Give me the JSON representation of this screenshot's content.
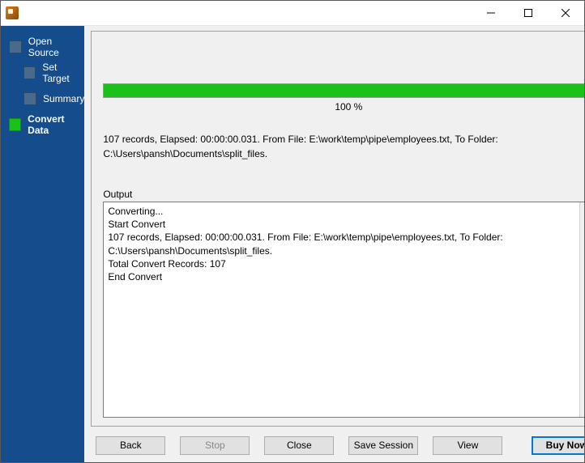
{
  "sidebar": {
    "items": [
      {
        "label": "Open Source"
      },
      {
        "label": "Set Target"
      },
      {
        "label": "Summary"
      },
      {
        "label": "Convert Data"
      }
    ]
  },
  "progress": {
    "percent_label": "100 %",
    "fill_pct": 100
  },
  "status": {
    "line": "107 records,    Elapsed: 00:00:00.031.    From File: E:\\work\\temp\\pipe\\employees.txt,    To Folder: C:\\Users\\pansh\\Documents\\split_files."
  },
  "output": {
    "label": "Output",
    "lines": [
      "Converting...",
      "Start Convert",
      "107 records,    Elapsed: 00:00:00.031.    From File: E:\\work\\temp\\pipe\\employees.txt,    To Folder: C:\\Users\\pansh\\Documents\\split_files.",
      "Total Convert Records: 107",
      "End Convert"
    ]
  },
  "buttons": {
    "back": "Back",
    "stop": "Stop",
    "close": "Close",
    "save_session": "Save Session",
    "view": "View",
    "buy_now": "Buy Now"
  }
}
